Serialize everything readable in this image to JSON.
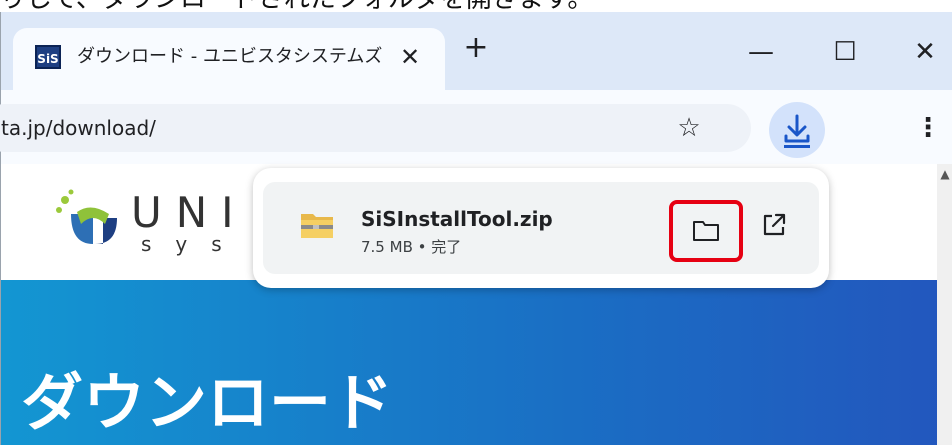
{
  "caption": "りして、ダウンロードされたフォルダを開きます。",
  "tab": {
    "favicon_text": "SiS",
    "title": "ダウンロード - ユニビスタシステムズ",
    "close_glyph": "✕"
  },
  "new_tab_glyph": "+",
  "window_controls": {
    "minimize": "—",
    "maximize": "☐",
    "close": "✕"
  },
  "omnibox": {
    "url": "ta.jp/download/",
    "star_glyph": "☆"
  },
  "menu_glyph": "⋮",
  "site": {
    "logo_text": "UNI",
    "logo_sub": "sys",
    "hero_title": "ダウンロード"
  },
  "download_panel": {
    "file_name": "SiSInstallTool.zip",
    "file_meta": "7.5 MB • 完了"
  },
  "colors": {
    "highlight": "#e60012",
    "download_button_bg": "#d3e2fb",
    "hero_start": "#1396d2",
    "hero_end": "#2356bd"
  }
}
